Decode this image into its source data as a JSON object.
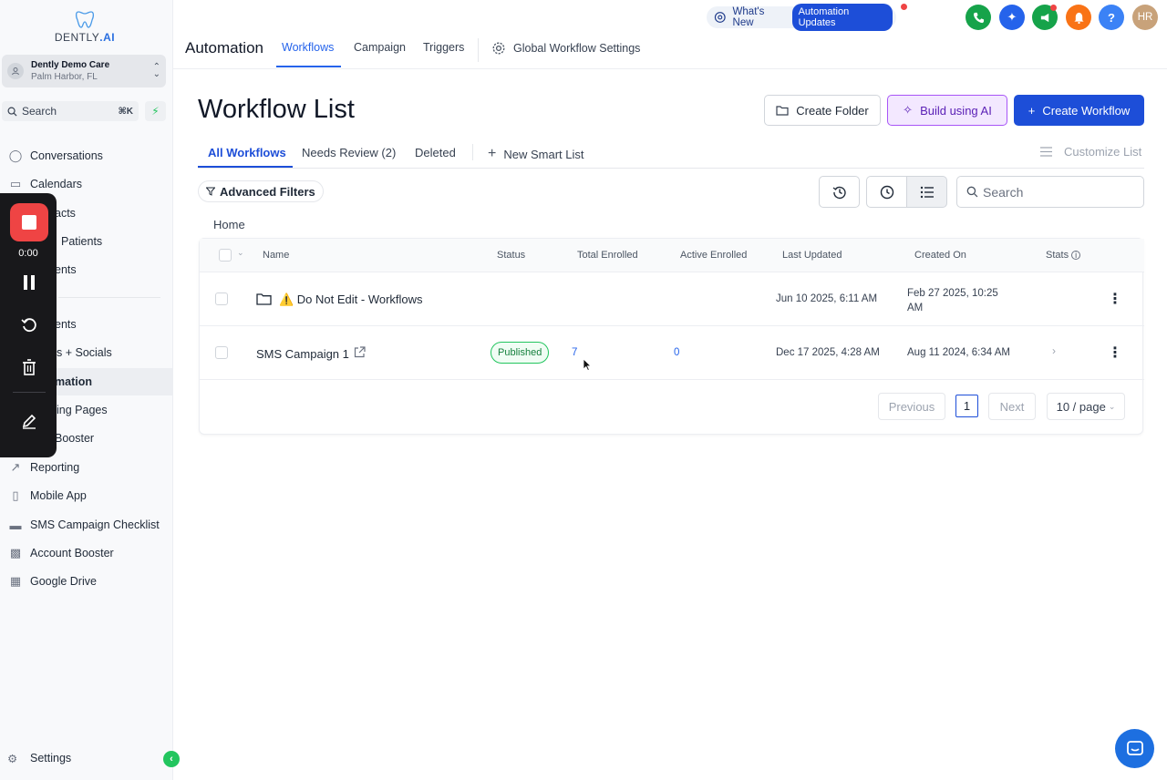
{
  "brand": {
    "logo_text": "DENTLY",
    "logo_suffix": ".AI"
  },
  "account": {
    "name": "Dently Demo Care",
    "location": "Palm Harbor, FL"
  },
  "sidebar": {
    "search_label": "Search",
    "search_shortcut": "⌘K",
    "items": [
      {
        "label": "Conversations"
      },
      {
        "label": "Calendars"
      },
      {
        "label": "acts"
      },
      {
        "label": "Patients"
      },
      {
        "label": "ents"
      },
      {
        "label": "ents"
      },
      {
        "label": "s + Socials"
      },
      {
        "label": "mation"
      },
      {
        "label": "ing Pages"
      },
      {
        "label": "Booster"
      },
      {
        "label": "Reporting"
      },
      {
        "label": "Mobile App"
      },
      {
        "label": "SMS Campaign Checklist"
      },
      {
        "label": "Account Booster"
      },
      {
        "label": "Google Drive"
      }
    ],
    "settings_label": "Settings"
  },
  "recorder": {
    "time": "0:00"
  },
  "topbar": {
    "whats_new": "What's New",
    "updates_pill": "Automation Updates",
    "user_initials": "HR",
    "colors": {
      "phone": "#16a34a",
      "ai": "#2563eb",
      "megaphone": "#16a34a",
      "bell": "#f97316",
      "help": "#3b82f6",
      "avatar": "#c8a27a"
    }
  },
  "header": {
    "section_title": "Automation",
    "tabs": [
      {
        "label": "Workflows"
      },
      {
        "label": "Campaign"
      },
      {
        "label": "Triggers"
      }
    ],
    "global_settings": "Global Workflow Settings"
  },
  "main": {
    "title": "Workflow List",
    "create_folder": "Create Folder",
    "build_ai": "Build using AI",
    "create_workflow": "Create Workflow",
    "subtabs": [
      {
        "label": "All Workflows"
      },
      {
        "label": "Needs Review (2)"
      },
      {
        "label": "Deleted"
      }
    ],
    "new_smart_list": "New Smart List",
    "customize_list": "Customize List",
    "advanced_filters": "Advanced Filters",
    "search_placeholder": "Search",
    "breadcrumb": "Home"
  },
  "table": {
    "columns": [
      "Name",
      "Status",
      "Total Enrolled",
      "Active Enrolled",
      "Last Updated",
      "Created On",
      "Stats"
    ],
    "rows": [
      {
        "name": "⚠️ Do Not Edit - Workflows",
        "status": "",
        "total": "",
        "active": "",
        "updated": "Jun 10 2025, 6:11 AM",
        "created_line1": "Feb 27 2025, 10:25",
        "created_line2": "AM"
      },
      {
        "name": "SMS Campaign 1",
        "status": "Published",
        "total": "7",
        "active": "0",
        "updated": "Dec 17 2025, 4:28 AM",
        "created_line1": "Aug 11 2024, 6:34 AM",
        "created_line2": ""
      }
    ]
  },
  "pagination": {
    "previous": "Previous",
    "page": "1",
    "next": "Next",
    "per_page": "10 / page"
  }
}
